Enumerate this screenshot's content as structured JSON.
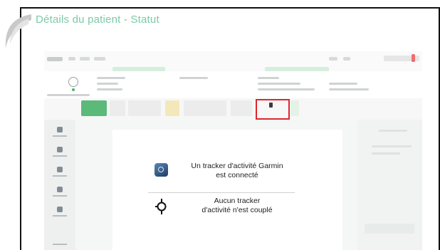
{
  "slide": {
    "title": "Détails du patient - Statut"
  },
  "dialog": {
    "garmin_line1": "Un tracker d'activité Garmin",
    "garmin_line2": "est connecté",
    "none_line1": "Aucun tracker",
    "none_line2": "d'activité n'est couplé"
  },
  "icons": {
    "garmin": "garmin-watch-icon",
    "unpaired": "unlinked-device-icon",
    "activity_tracker": "activity-tracker-icon"
  },
  "colors": {
    "title": "#7ccaa8",
    "highlight": "#e0262c",
    "accent_green": "#5bb97a"
  }
}
